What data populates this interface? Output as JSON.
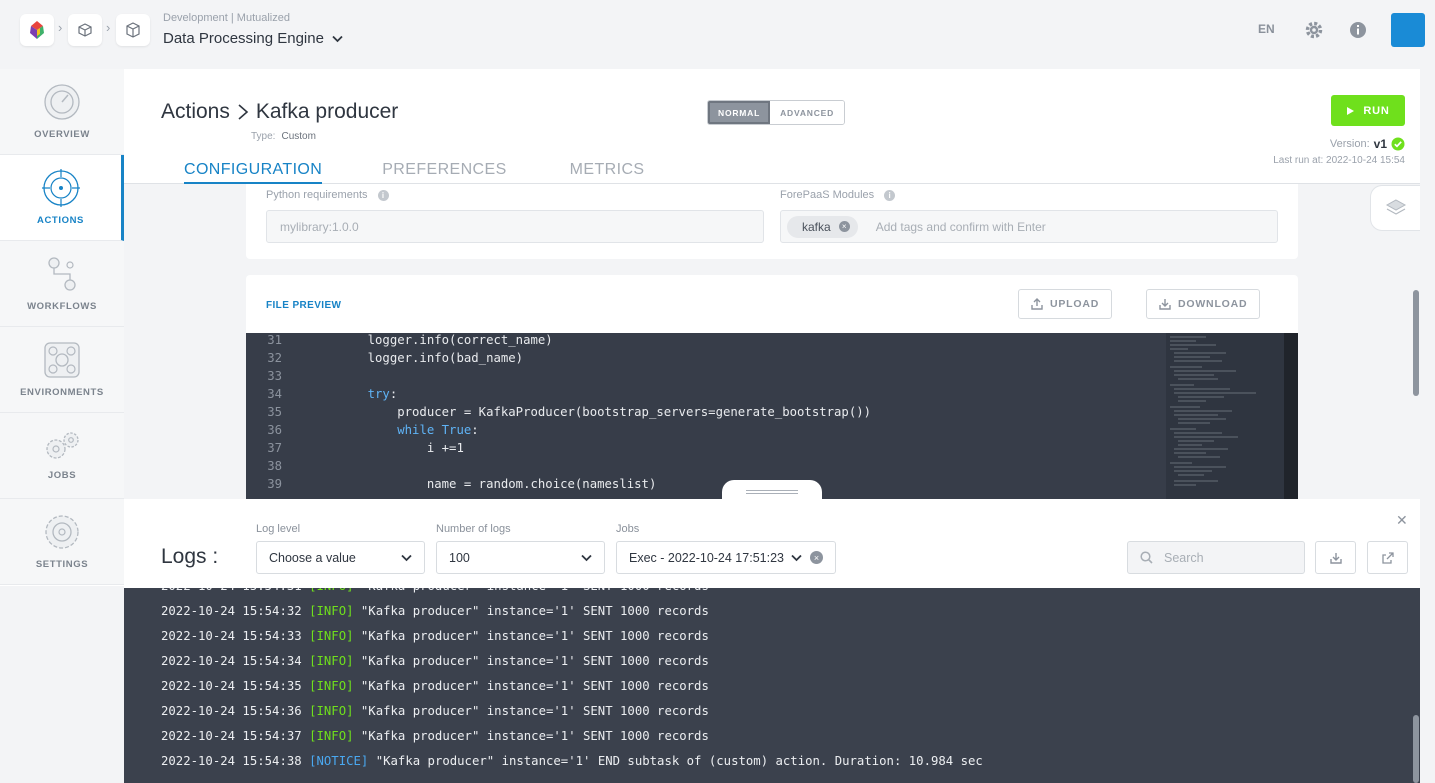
{
  "topbar": {
    "subtitle": "Development | Mutualized",
    "app_title": "Data Processing Engine",
    "lang": "EN"
  },
  "sidebar": {
    "items": [
      {
        "label": "OVERVIEW",
        "icon": "gauge-icon"
      },
      {
        "label": "ACTIONS",
        "icon": "target-icon"
      },
      {
        "label": "WORKFLOWS",
        "icon": "workflow-icon"
      },
      {
        "label": "ENVIRONMENTS",
        "icon": "cluster-icon"
      },
      {
        "label": "JOBS",
        "icon": "gears-icon"
      },
      {
        "label": "SETTINGS",
        "icon": "settings-icon"
      }
    ],
    "active": "ACTIONS"
  },
  "header": {
    "breadcrumb_root": "Actions",
    "title": "Kafka producer",
    "type_label": "Type:",
    "type_value": "Custom",
    "mode_normal": "NORMAL",
    "mode_advanced": "ADVANCED",
    "tabs": [
      "CONFIGURATION",
      "PREFERENCES",
      "METRICS"
    ],
    "active_tab": "CONFIGURATION",
    "run_label": "RUN",
    "version_label": "Version:",
    "version_value": "v1",
    "last_run": "Last run at: 2022-10-24 15:54"
  },
  "requirements": {
    "python_label": "Python requirements",
    "python_placeholder": "mylibrary:1.0.0",
    "modules_label": "ForePaaS Modules",
    "module_tag": "kafka",
    "modules_placeholder": "Add tags and confirm with Enter"
  },
  "file_preview": {
    "title": "FILE PREVIEW",
    "upload_label": "UPLOAD",
    "download_label": "DOWNLOAD",
    "lines": [
      {
        "n": "31",
        "text": "    logger.info(correct_name)"
      },
      {
        "n": "32",
        "text": "    logger.info(bad_name)"
      },
      {
        "n": "33",
        "text": ""
      },
      {
        "n": "34",
        "kw": "try",
        "text": ":"
      },
      {
        "n": "35",
        "text": "        producer = KafkaProducer(bootstrap_servers=generate_bootstrap())"
      },
      {
        "n": "36",
        "kw": "while True",
        "text": ":"
      },
      {
        "n": "37",
        "text": "            i +=1"
      },
      {
        "n": "38",
        "text": ""
      },
      {
        "n": "39",
        "text": "            name = random.choice(nameslist)"
      }
    ]
  },
  "logs": {
    "title": "Logs :",
    "log_level_label": "Log level",
    "log_level_value": "Choose a value",
    "count_label": "Number of logs",
    "count_value": "100",
    "jobs_label": "Jobs",
    "jobs_value": "Exec - 2022-10-24 17:51:23",
    "search_placeholder": "Search",
    "lines": [
      {
        "ts": "2022-10-24 15:54:32",
        "level": "[INFO]",
        "msg": "\"Kafka producer\" instance='1' SENT 1000 records"
      },
      {
        "ts": "2022-10-24 15:54:33",
        "level": "[INFO]",
        "msg": "\"Kafka producer\" instance='1' SENT 1000 records"
      },
      {
        "ts": "2022-10-24 15:54:34",
        "level": "[INFO]",
        "msg": "\"Kafka producer\" instance='1' SENT 1000 records"
      },
      {
        "ts": "2022-10-24 15:54:35",
        "level": "[INFO]",
        "msg": "\"Kafka producer\" instance='1' SENT 1000 records"
      },
      {
        "ts": "2022-10-24 15:54:36",
        "level": "[INFO]",
        "msg": "\"Kafka producer\" instance='1' SENT 1000 records"
      },
      {
        "ts": "2022-10-24 15:54:37",
        "level": "[INFO]",
        "msg": "\"Kafka producer\" instance='1' SENT 1000 records"
      },
      {
        "ts": "2022-10-24 15:54:38",
        "level": "[NOTICE]",
        "msg": "\"Kafka producer\" instance='1' END subtask of (custom) action. Duration: 10.984 sec"
      }
    ]
  },
  "colors": {
    "accent": "#1783c6",
    "run": "#6fe01c",
    "info": "#6fe01c",
    "notice": "#4aa8f0"
  }
}
